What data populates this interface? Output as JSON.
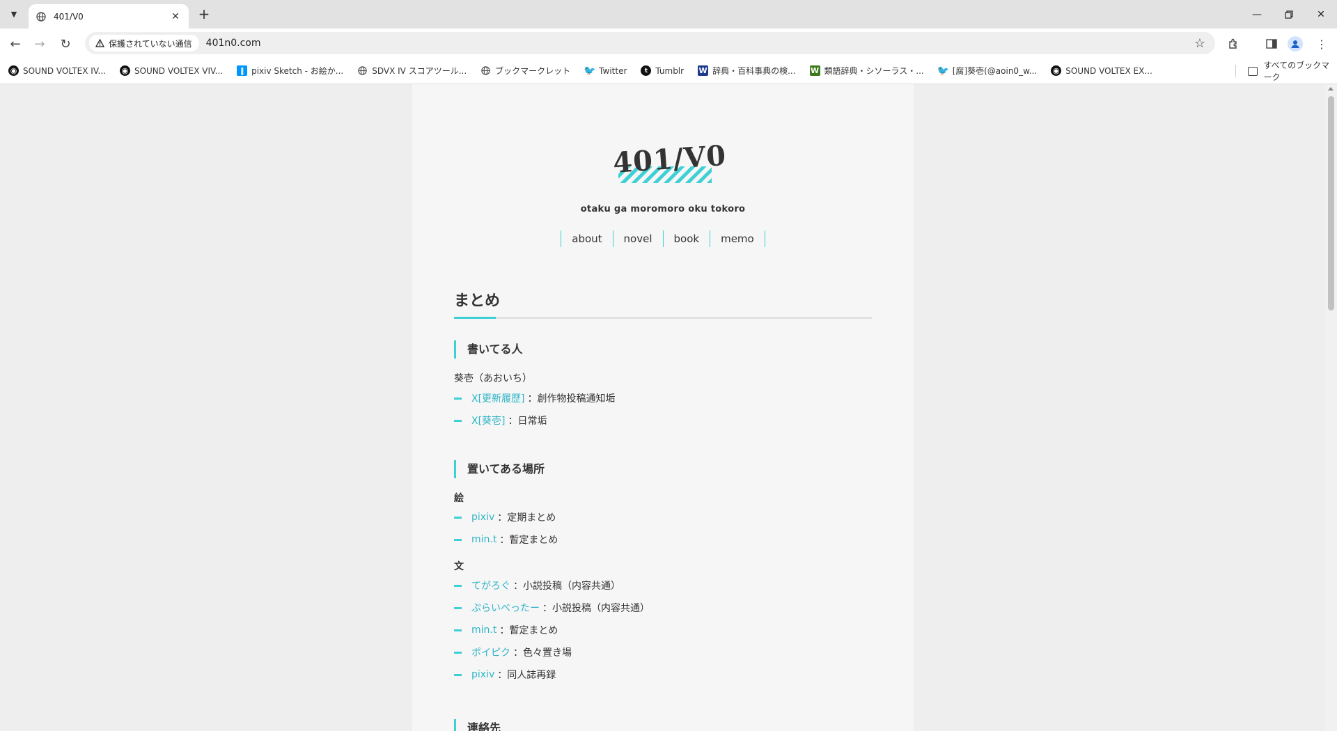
{
  "browser": {
    "tab_title": "401/V0",
    "security_label": "保護されていない通信",
    "url": "401n0.com",
    "bookmarks": [
      {
        "label": "SOUND VOLTEX IV...",
        "icon": "sdvx-icon"
      },
      {
        "label": "SOUND VOLTEX VIV...",
        "icon": "sdvx-icon"
      },
      {
        "label": "pixiv Sketch - お絵か...",
        "icon": "pixiv-icon"
      },
      {
        "label": "SDVX IV スコアツール...",
        "icon": "globe-icon"
      },
      {
        "label": "ブックマークレット",
        "icon": "globe-icon"
      },
      {
        "label": "Twitter",
        "icon": "twitter-icon"
      },
      {
        "label": "Tumblr",
        "icon": "tumblr-icon"
      },
      {
        "label": "辞典・百科事典の検...",
        "icon": "weblio-icon"
      },
      {
        "label": "類語辞典・シソーラス・...",
        "icon": "weblio-thesaurus-icon"
      },
      {
        "label": "[腐]葵壱(@aoin0_w...",
        "icon": "twitter-icon"
      },
      {
        "label": "SOUND VOLTEX EX...",
        "icon": "sdvx-icon"
      }
    ],
    "all_bookmarks_label": "すべてのブックマーク"
  },
  "site": {
    "logo": "401/V0",
    "tagline": "otaku ga moromoro oku tokoro",
    "nav": [
      "about",
      "novel",
      "book",
      "memo"
    ]
  },
  "main": {
    "heading": "まとめ",
    "author_section": {
      "heading": "書いてる人",
      "name": "葵壱（あおいち）",
      "links": [
        {
          "link": "X[更新履歴]",
          "desc": "：創作物投稿通知垢"
        },
        {
          "link": "X[葵壱]",
          "desc": "：日常垢"
        }
      ]
    },
    "places_section": {
      "heading": "置いてある場所",
      "art_label": "絵",
      "art_links": [
        {
          "link": "pixiv",
          "desc": "：定期まとめ"
        },
        {
          "link": "min.t",
          "desc": "：暫定まとめ"
        }
      ],
      "text_label": "文",
      "text_links": [
        {
          "link": "てがろぐ",
          "desc": "：小説投稿（内容共通）"
        },
        {
          "link": "ぷらいべったー",
          "desc": "：小説投稿（内容共通）"
        },
        {
          "link": "min.t",
          "desc": "：暫定まとめ"
        },
        {
          "link": "ポイピク",
          "desc": "：色々置き場"
        },
        {
          "link": "pixiv",
          "desc": "：同人誌再録"
        }
      ]
    },
    "contact_section": {
      "heading": "連絡先"
    }
  },
  "colors": {
    "accent": "#3ed0d4",
    "link": "#2fb4c6",
    "text": "#333333",
    "page_bg": "#eeeeee",
    "card_bg": "#f6f6f6"
  }
}
